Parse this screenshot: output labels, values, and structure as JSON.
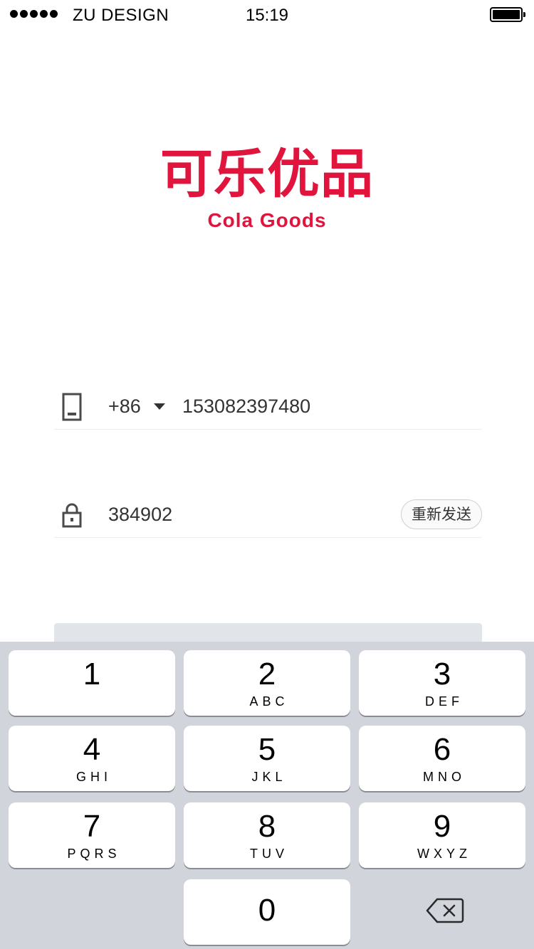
{
  "status_bar": {
    "carrier": "ZU DESIGN",
    "time": "15:19"
  },
  "logo": {
    "cn": "可乐优品",
    "en": "Cola Goods",
    "color": "#e0143c"
  },
  "phone_row": {
    "country_code": "+86",
    "phone": "153082397480"
  },
  "code_row": {
    "code": "384902",
    "resend_label": "重新发送"
  },
  "keyboard": {
    "keys": [
      {
        "num": "1",
        "letters": ""
      },
      {
        "num": "2",
        "letters": "ABC"
      },
      {
        "num": "3",
        "letters": "DEF"
      },
      {
        "num": "4",
        "letters": "GHI"
      },
      {
        "num": "5",
        "letters": "JKL"
      },
      {
        "num": "6",
        "letters": "MNO"
      },
      {
        "num": "7",
        "letters": "PQRS"
      },
      {
        "num": "8",
        "letters": "TUV"
      },
      {
        "num": "9",
        "letters": "WXYZ"
      },
      {
        "num": "0",
        "letters": ""
      }
    ]
  }
}
